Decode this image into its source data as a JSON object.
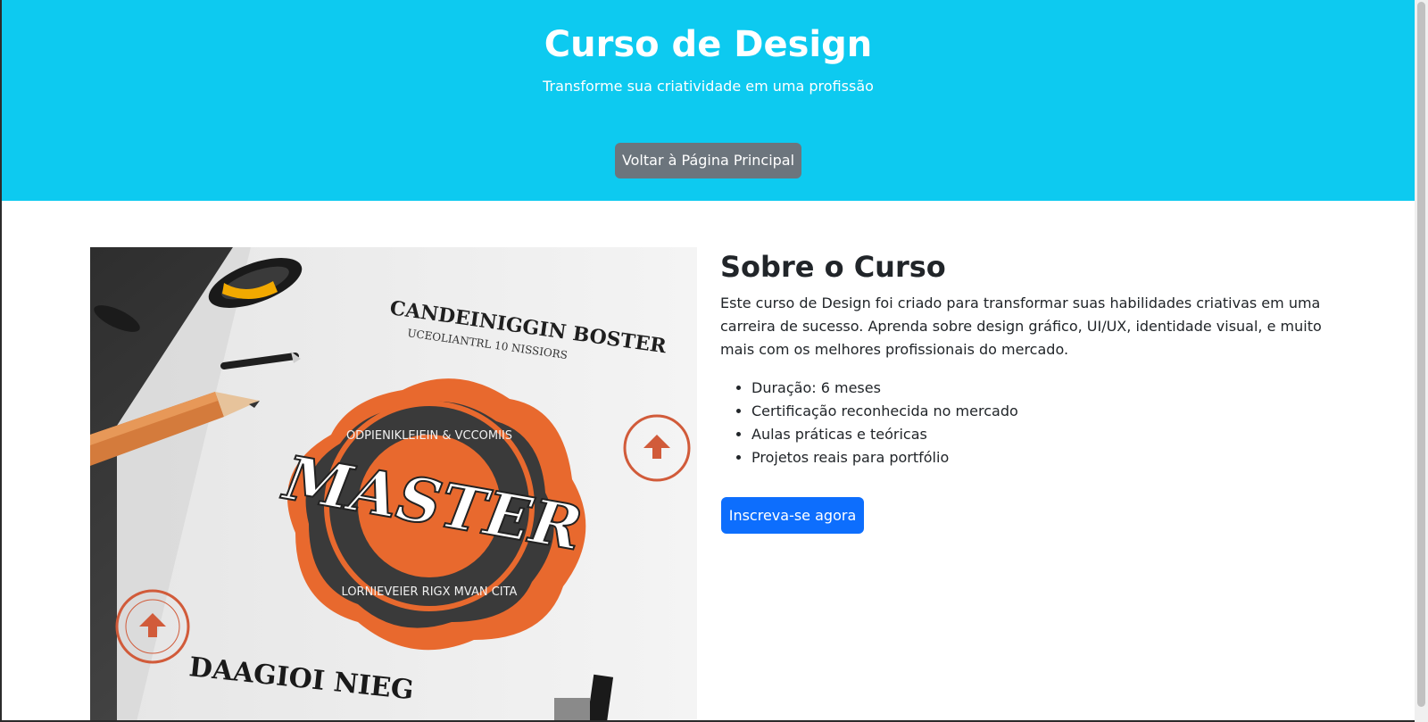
{
  "hero": {
    "title": "Curso de Design",
    "subtitle": "Transforme sua criatividade em uma profissão",
    "back_button": "Voltar à Página Principal",
    "background_color": "#0dcaf0"
  },
  "about": {
    "title": "Sobre o Curso",
    "description": "Este curso de Design foi criado para transformar suas habilidades criativas em uma carreira de sucesso. Aprenda sobre design gráfico, UI/UX, identidade visual, e muito mais com os melhores profissionais do mercado.",
    "features": [
      "Duração: 6 meses",
      "Certificação reconhecida no mercado",
      "Aulas práticas e teóricas",
      "Projetos reais para portfólio"
    ],
    "enroll_button": "Inscreva-se agora",
    "enroll_color": "#0d6efd"
  },
  "image": {
    "center_text": "MASTER",
    "top_text": "CANDEINIGGIN BOSTER",
    "bottom_text": "DAAGIOI NIEG"
  },
  "colors": {
    "back_button": "#6c757d",
    "badge_orange": "#e8692e"
  }
}
